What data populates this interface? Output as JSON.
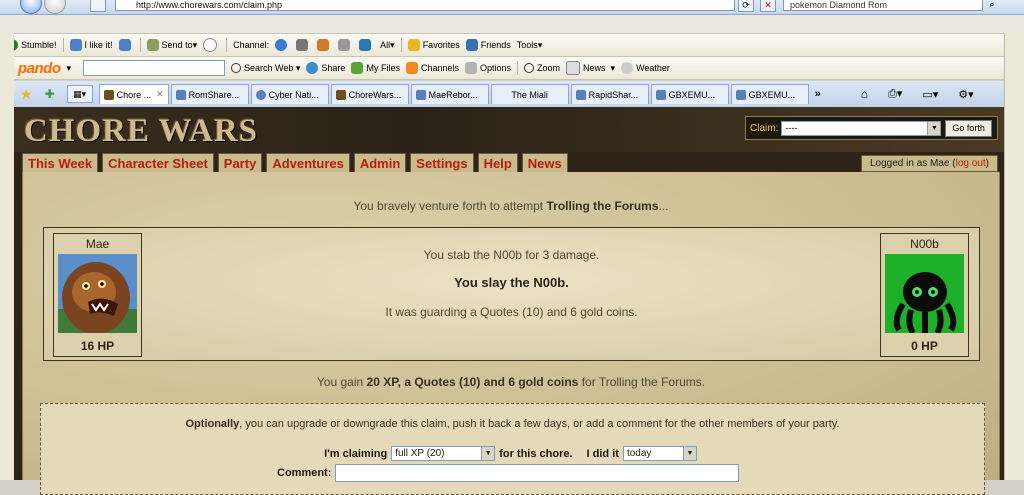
{
  "browser": {
    "url": "http://www.chorewars.com/claim.php",
    "search_value": "pokemon Diamond Rom",
    "toolbar1": {
      "stumble": "Stumble!",
      "like": "I like it!",
      "send_to": "Send to",
      "channel": "Channel:",
      "all": "All",
      "favorites": "Favorites",
      "friends": "Friends",
      "tools": "Tools"
    },
    "toolbar2": {
      "pando": "pando",
      "search_web": "Search Web",
      "share": "Share",
      "my_files": "My Files",
      "channels": "Channels",
      "options": "Options",
      "zoom": "Zoom",
      "news": "News",
      "weather": "Weather"
    },
    "tabs": [
      {
        "label": "Chore ..."
      },
      {
        "label": "RomShare..."
      },
      {
        "label": "Cyber Nati..."
      },
      {
        "label": "ChoreWars..."
      },
      {
        "label": "MaeRebor..."
      },
      {
        "label": "The Miali"
      },
      {
        "label": "RapidShar..."
      },
      {
        "label": "GBXEMU..."
      },
      {
        "label": "GBXEMU..."
      }
    ],
    "tabs_more": "»"
  },
  "site": {
    "logo": "CHORE WARS",
    "claim_label": "Claim:",
    "claim_value": "----",
    "go_button": "Go forth",
    "nav": [
      "This Week",
      "Character Sheet",
      "Party",
      "Adventures",
      "Admin",
      "Settings",
      "Help",
      "News"
    ],
    "logged_in_prefix": "Logged in as Mae (",
    "logout": "log out",
    "logged_in_suffix": ")"
  },
  "battle": {
    "intro_prefix": "You bravely venture forth to attempt ",
    "chore": "Trolling the Forums",
    "intro_suffix": "...",
    "player": {
      "name": "Mae",
      "hp": "16 HP"
    },
    "enemy": {
      "name": "N00b",
      "hp": "0 HP"
    },
    "line1": "You stab the N00b for 3 damage.",
    "line2": "You slay the N00b.",
    "line3": "It was guarding a Quotes (10) and 6 gold coins.",
    "gain_prefix": "You gain ",
    "gain_bold": "20 XP, a Quotes (10) and 6 gold coins",
    "gain_suffix": " for Trolling the Forums."
  },
  "options": {
    "lead_bold": "Optionally",
    "lead_rest": ", you can upgrade or downgrade this claim, push it back a few days, or add a comment for the other members of your party.",
    "claiming_label": "I'm claiming",
    "claiming_value": "full XP (20)",
    "for_chore": "for this chore.",
    "did_it_label": "I did it",
    "did_it_value": "today",
    "comment_label": "Comment:"
  },
  "colors": {
    "nav_text": "#b81d0c",
    "claim_label": "#e8c54a",
    "parchment": "#d7c9a2"
  }
}
